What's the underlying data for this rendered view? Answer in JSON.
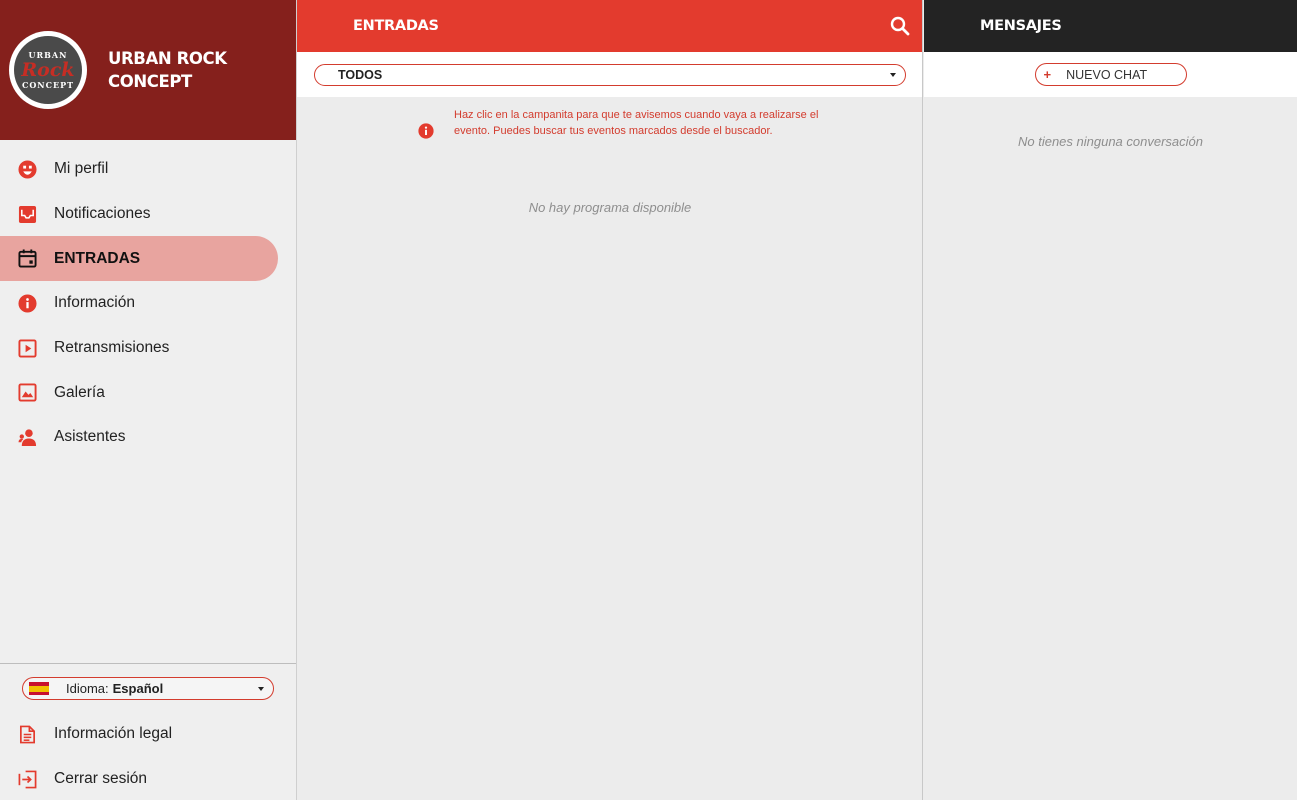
{
  "brand": {
    "line1": "URBAN ROCK",
    "line2": "CONCEPT",
    "logo_top": "URBAN",
    "logo_mid": "Rock",
    "logo_bottom": "CONCEPT"
  },
  "sidebar": {
    "items": [
      {
        "label": "Mi perfil",
        "icon": "face-icon"
      },
      {
        "label": "Notificaciones",
        "icon": "inbox-icon"
      },
      {
        "label": "ENTRADAS",
        "icon": "calendar-icon",
        "active": true
      },
      {
        "label": "Información",
        "icon": "info-icon"
      },
      {
        "label": "Retransmisiones",
        "icon": "play-icon"
      },
      {
        "label": "Galería",
        "icon": "image-icon"
      },
      {
        "label": "Asistentes",
        "icon": "people-icon"
      }
    ],
    "language": {
      "prefix": "Idioma:",
      "value": "Español"
    },
    "legal": "Información legal",
    "logout": "Cerrar sesión"
  },
  "center": {
    "title": "ENTRADAS",
    "filter": "TODOS",
    "notice": "Haz clic en la campanita para que te avisemos cuando vaya a realizarse el evento. Puedes buscar tus eventos marcados desde el buscador.",
    "empty": "No hay programa disponible"
  },
  "right": {
    "title": "MENSAJES",
    "new_chat_plus": "+",
    "new_chat": "NUEVO CHAT",
    "empty": "No tienes ninguna conversación"
  },
  "colors": {
    "accent": "#e33b2e",
    "brand_dark": "#85201c",
    "active_bg": "#e8a49f",
    "dark_header": "#232323"
  }
}
